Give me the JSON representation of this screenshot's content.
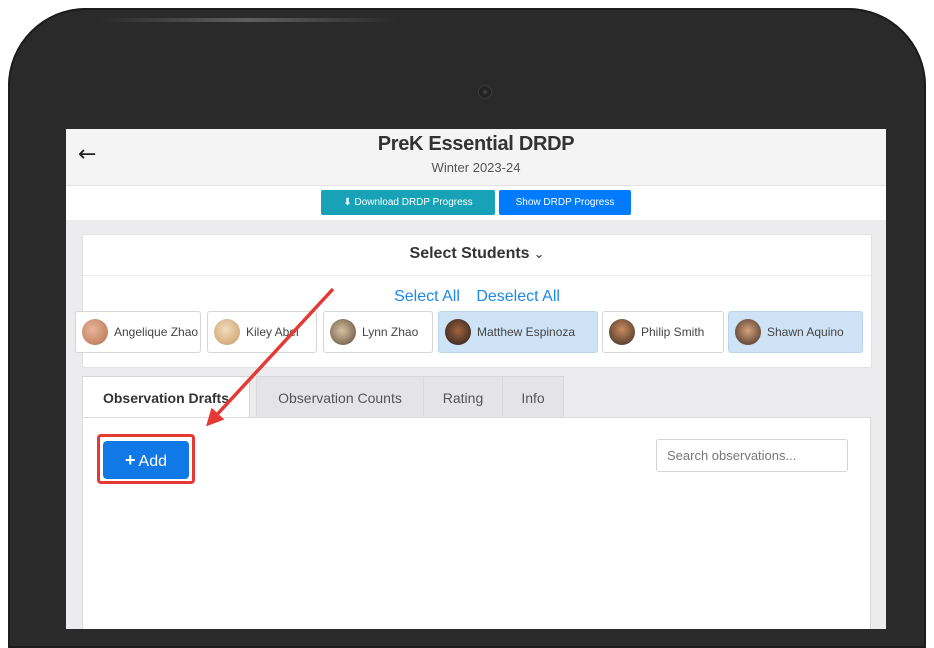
{
  "header": {
    "title": "PreK Essential DRDP",
    "subtitle": "Winter 2023-24",
    "back_icon": "arrow-left-icon"
  },
  "toolbar": {
    "download_label": "Download DRDP Progress",
    "download_icon": "download-icon",
    "show_label": "Show DRDP Progress"
  },
  "students": {
    "heading": "Select Students",
    "select_all": "Select All",
    "deselect_all": "Deselect All",
    "list": [
      {
        "name": "Angelique Zhao",
        "selected": false
      },
      {
        "name": "Kiley Abel",
        "selected": false
      },
      {
        "name": "Lynn Zhao",
        "selected": false
      },
      {
        "name": "Matthew Espinoza",
        "selected": true
      },
      {
        "name": "Philip Smith",
        "selected": false
      },
      {
        "name": "Shawn Aquino",
        "selected": true
      }
    ]
  },
  "tabs": [
    {
      "label": "Observation Drafts",
      "active": true
    },
    {
      "label": "Observation Counts",
      "active": false
    },
    {
      "label": "Rating",
      "active": false
    },
    {
      "label": "Info",
      "active": false
    }
  ],
  "panel": {
    "add_label": "Add",
    "search_placeholder": "Search observations..."
  },
  "colors": {
    "download_button": "#17a2b8",
    "show_button": "#007bff",
    "add_button": "#1178e8",
    "annotation": "#e53935",
    "selected_chip": "#cfe3f7"
  }
}
